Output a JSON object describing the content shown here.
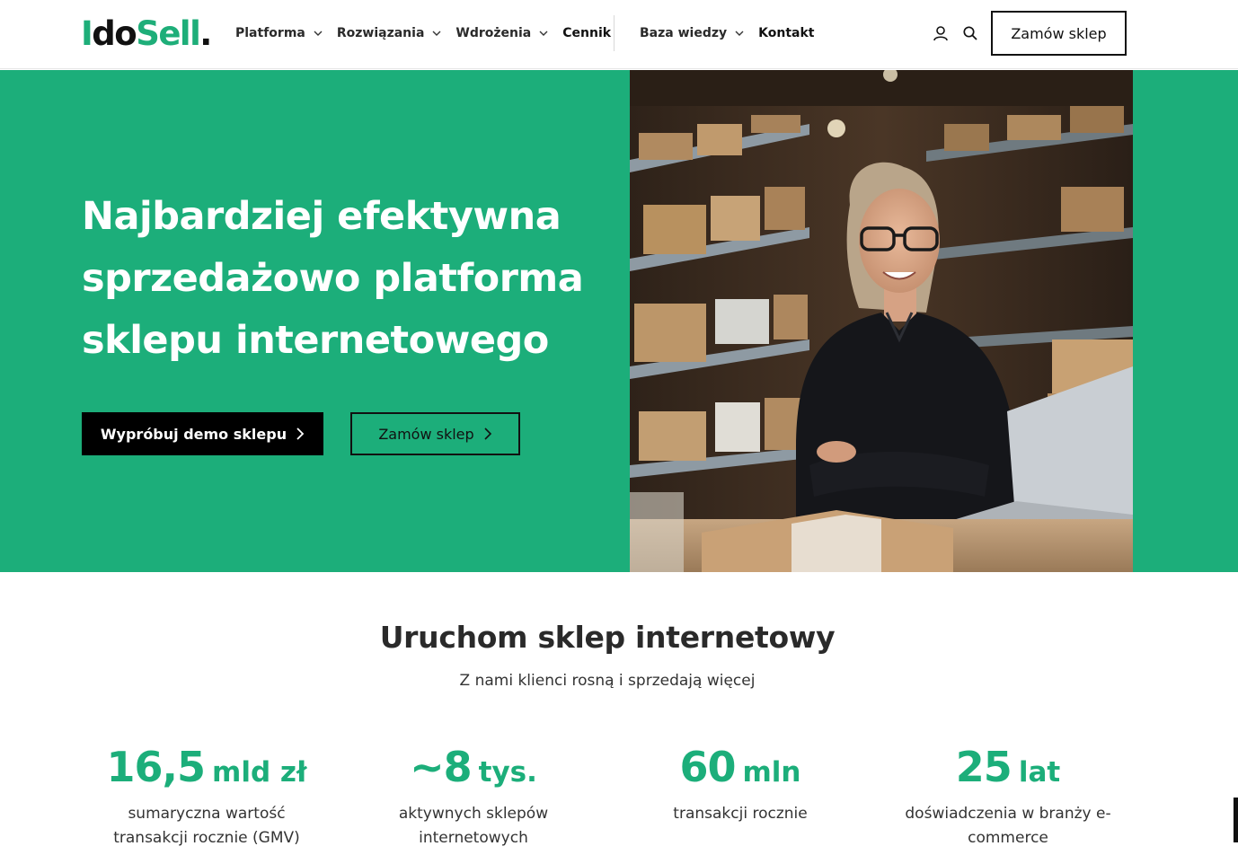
{
  "header": {
    "logo": {
      "part1": "I",
      "part2": "do",
      "part3": "Sell",
      "part4": "."
    },
    "nav": [
      {
        "label": "Platforma",
        "dropdown": true
      },
      {
        "label": "Rozwiązania",
        "dropdown": true
      },
      {
        "label": "Wdrożenia",
        "dropdown": true
      },
      {
        "label": "Cennik",
        "dropdown": false
      }
    ],
    "nav_secondary": [
      {
        "label": "Baza wiedzy",
        "dropdown": true
      },
      {
        "label": "Kontakt",
        "dropdown": false
      }
    ],
    "icons": [
      "user-icon",
      "search-icon",
      "chevron-down-icon"
    ],
    "cta_label": "Zamów sklep"
  },
  "hero": {
    "title_lines": [
      "Najbardziej efektywna",
      "sprzedażowo platforma",
      "sklepu internetowego"
    ],
    "btn_demo": "Wypróbuj demo sklepu",
    "btn_order": "Zamów sklep",
    "bg_color": "#1cae7a"
  },
  "section": {
    "title": "Uruchom sklep internetowy",
    "subtitle": "Z nami klienci rosną i sprzedają więcej"
  },
  "stats": [
    {
      "value": "16,5",
      "unit": "mld zł",
      "desc_lines": [
        "sumaryczna wartość",
        "transakcji rocznie (GMV)"
      ]
    },
    {
      "value": "~8",
      "unit": "tys.",
      "desc_lines": [
        "aktywnych sklepów",
        "internetowych"
      ]
    },
    {
      "value": "60",
      "unit": "mln",
      "desc_lines": [
        "transakcji rocznie"
      ]
    },
    {
      "value": "25",
      "unit": "lat",
      "desc_lines": [
        "doświadczenia w branży e-",
        "commerce"
      ]
    }
  ],
  "colors": {
    "brand_green": "#1cae7a",
    "dark": "#111111"
  }
}
